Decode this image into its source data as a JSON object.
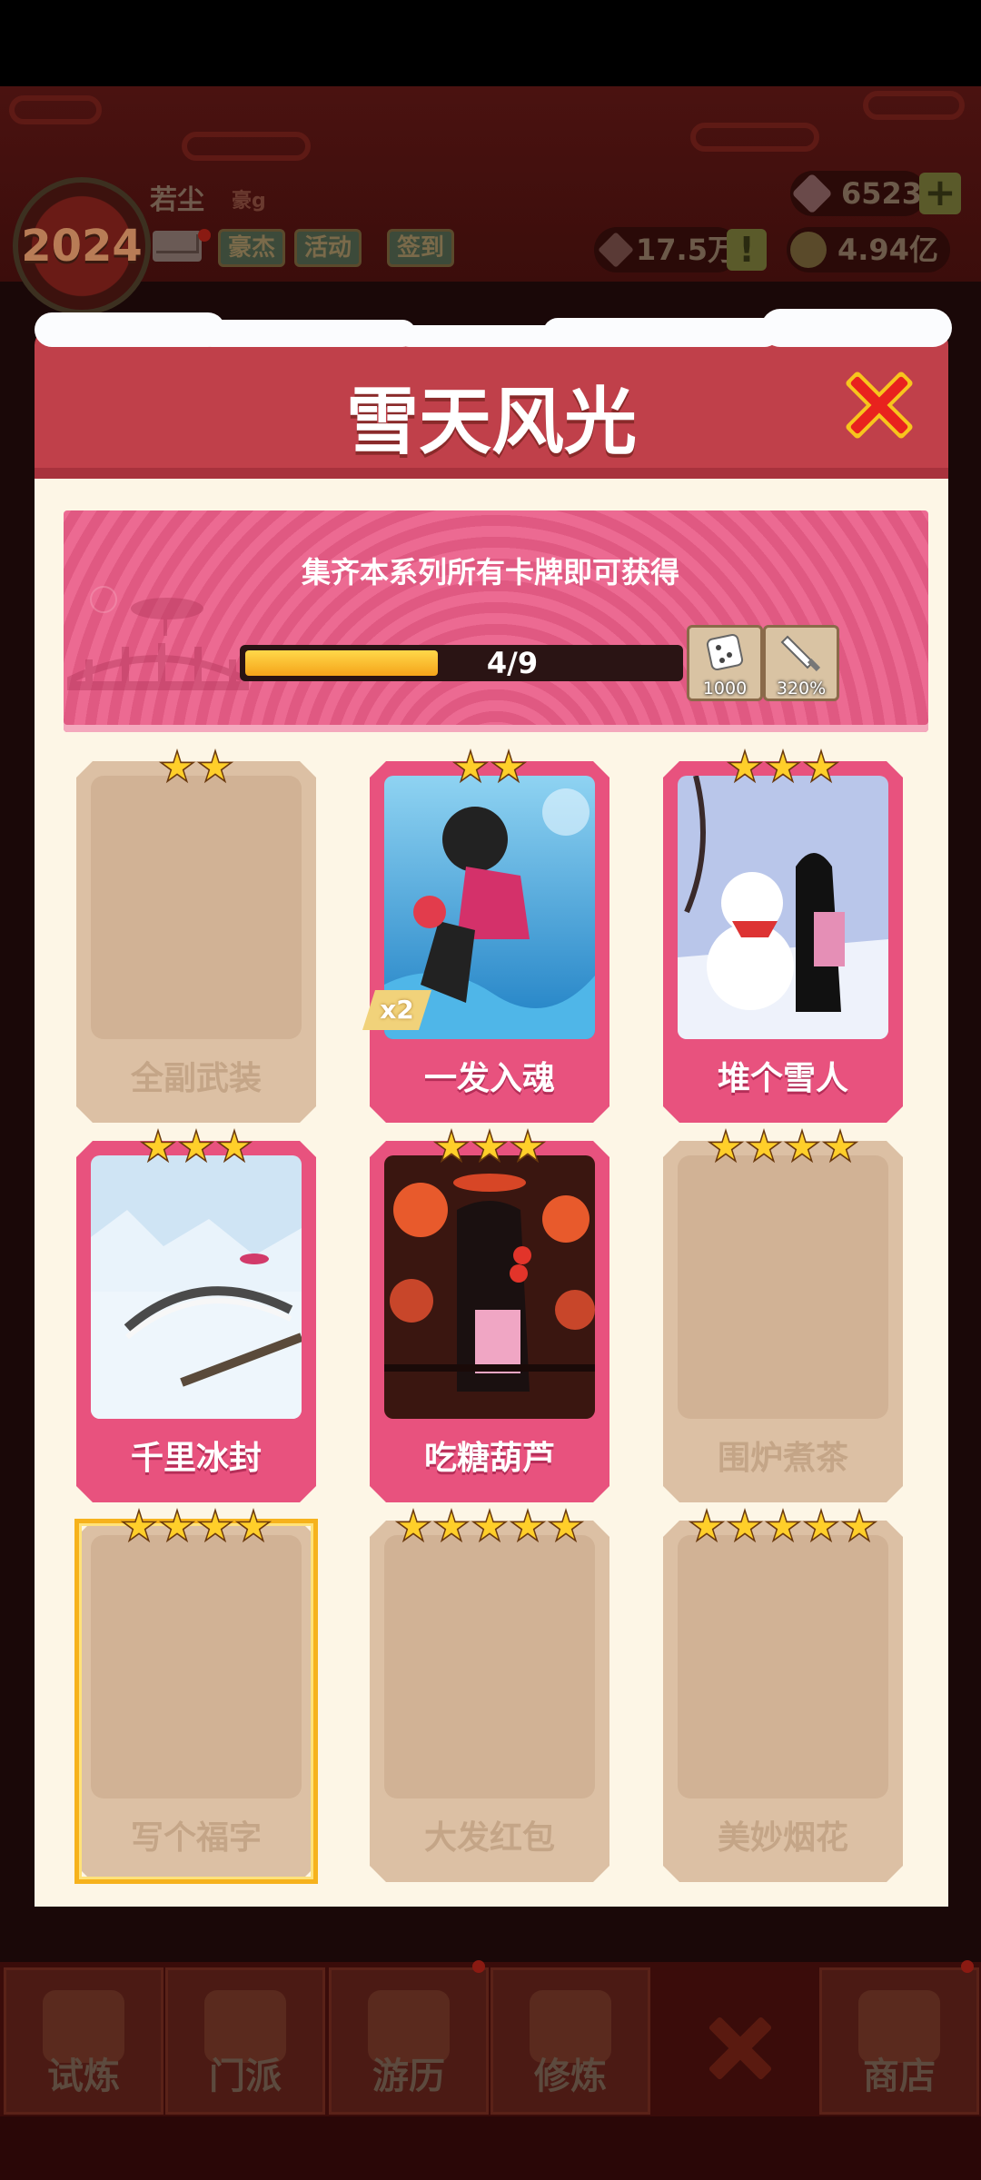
{
  "header": {
    "player_name": "若尘",
    "player_rank": "豪g",
    "year_badge": "2024",
    "buttons": [
      "豪杰",
      "活动",
      "签到"
    ],
    "resources": {
      "gems": "6523",
      "power": "17.5万",
      "gold": "4.94亿"
    }
  },
  "modal": {
    "title": "雪天风光",
    "banner_text": "集齐本系列所有卡牌即可获得",
    "progress": {
      "current": 4,
      "total": 9,
      "label": "4/9"
    },
    "rewards": [
      {
        "icon": "dice-icon",
        "label": "1000"
      },
      {
        "icon": "dagger-icon",
        "label": "320%"
      }
    ],
    "cards": [
      {
        "name": "全副武装",
        "stars": 2,
        "unlocked": false,
        "count": ""
      },
      {
        "name": "一发入魂",
        "stars": 2,
        "unlocked": true,
        "count": "x2"
      },
      {
        "name": "堆个雪人",
        "stars": 3,
        "unlocked": true,
        "count": ""
      },
      {
        "name": "千里冰封",
        "stars": 3,
        "unlocked": true,
        "count": ""
      },
      {
        "name": "吃糖葫芦",
        "stars": 3,
        "unlocked": true,
        "count": ""
      },
      {
        "name": "围炉煮茶",
        "stars": 4,
        "unlocked": false,
        "count": ""
      },
      {
        "name": "写个福字",
        "stars": 4,
        "unlocked": false,
        "count": "",
        "golden": true
      },
      {
        "name": "大发红包",
        "stars": 5,
        "unlocked": false,
        "count": ""
      },
      {
        "name": "美妙烟花",
        "stars": 5,
        "unlocked": false,
        "count": ""
      }
    ]
  },
  "bottom_nav": [
    "试炼",
    "门派",
    "游历",
    "修炼",
    "",
    "商店"
  ],
  "colors": {
    "title_bar": "#c0404a",
    "card_pink": "#e8527e",
    "card_locked": "#dcc0a4",
    "star": "#ffcf2a",
    "progress": "#f5a41a"
  }
}
